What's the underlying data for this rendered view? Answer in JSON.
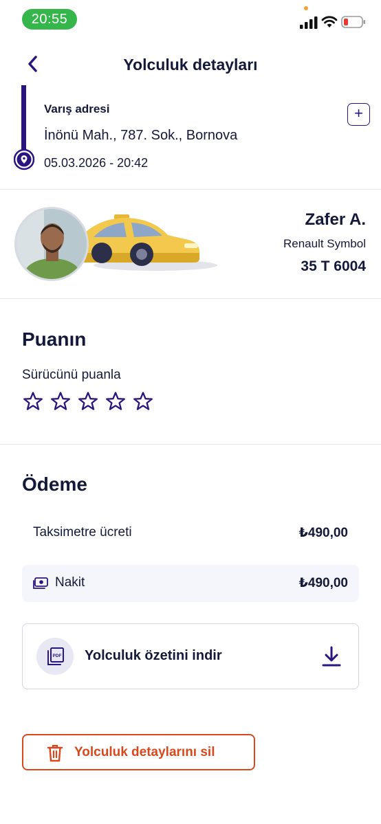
{
  "status_bar": {
    "time": "20:55",
    "icons": [
      "signal-icon",
      "wifi-icon",
      "battery-low-icon"
    ]
  },
  "header": {
    "title": "Yolculuk detayları",
    "back_icon": "chevron-left-icon"
  },
  "destination": {
    "label": "Varış adresi",
    "address": "İnönü Mah., 787. Sok., Bornova",
    "datetime": "05.03.2026 - 20:42",
    "add_label": "+"
  },
  "driver": {
    "name": "Zafer A.",
    "car_model": "Renault Symbol",
    "plate": "35 T 6004"
  },
  "rating": {
    "title": "Puanın",
    "prompt": "Sürücünü puanla",
    "max_stars": 5,
    "selected": 0
  },
  "payment": {
    "title": "Ödeme",
    "fare_label": "Taksimetre ücreti",
    "fare_value": "₺490,00",
    "method_label": "Nakit",
    "method_value": "₺490,00"
  },
  "download": {
    "label": "Yolculuk özetini indir",
    "pdf_text": "PDF"
  },
  "delete": {
    "label": "Yolculuk detaylarını sil"
  },
  "colors": {
    "primary": "#2a1580",
    "text": "#14193a",
    "danger": "#d9481c",
    "status_green": "#34b64a"
  }
}
